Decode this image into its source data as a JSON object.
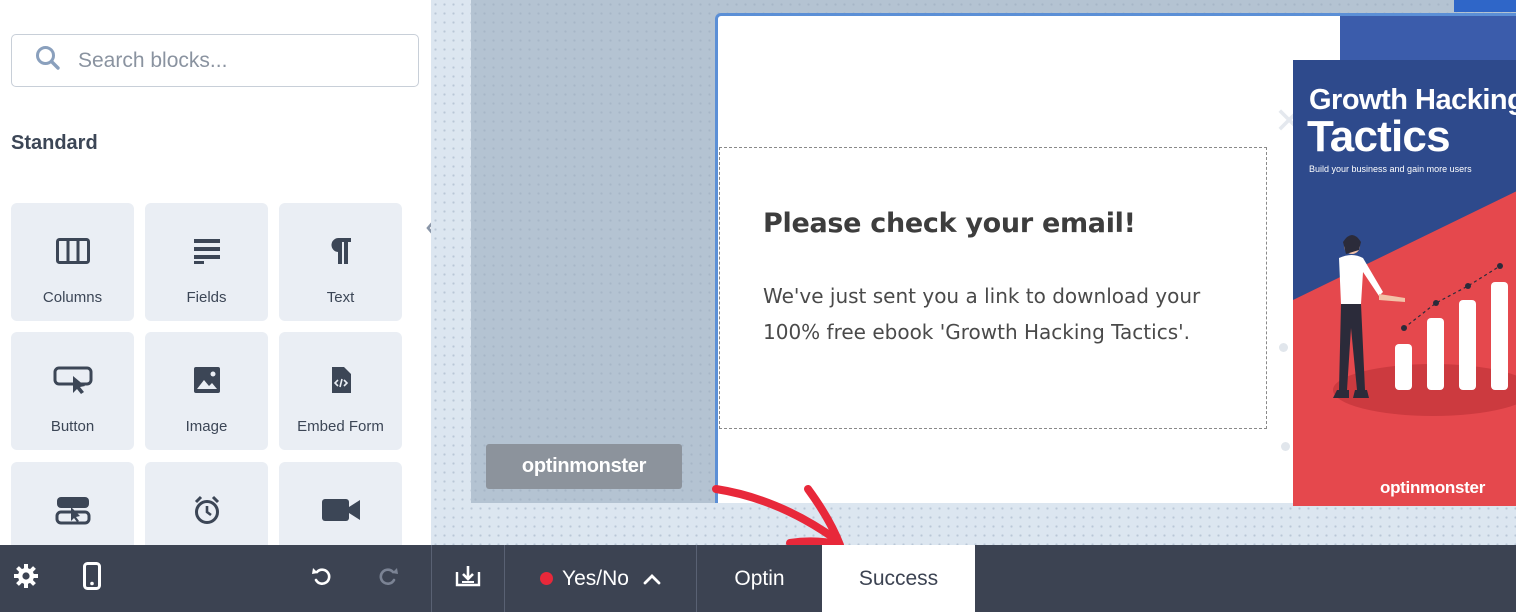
{
  "sidebar": {
    "search": {
      "placeholder": "Search blocks..."
    },
    "section_title": "Standard",
    "blocks": [
      {
        "label": "Columns",
        "icon": "columns-icon"
      },
      {
        "label": "Fields",
        "icon": "fields-icon"
      },
      {
        "label": "Text",
        "icon": "paragraph-icon"
      },
      {
        "label": "Button",
        "icon": "button-icon"
      },
      {
        "label": "Image",
        "icon": "image-icon"
      },
      {
        "label": "Embed Form",
        "icon": "embed-form-icon"
      },
      {
        "label": "",
        "icon": "toggle-button-icon"
      },
      {
        "label": "",
        "icon": "alarm-clock-icon"
      },
      {
        "label": "",
        "icon": "video-camera-icon"
      }
    ]
  },
  "canvas": {
    "badge_text": "optinmonster",
    "popup": {
      "heading": "Please check your email!",
      "body": "We've just sent you a link to download your 100% free ebook 'Growth Hacking Tactics'."
    },
    "ebook": {
      "title_line1": "Growth Hacking",
      "title_line2": "Tactics",
      "subtitle": "Build your business and gain more users",
      "brand": "optinmonster",
      "colors": {
        "top": "#3b5cab",
        "bottom": "#e5484d"
      }
    }
  },
  "bottombar": {
    "icons": [
      "gear-icon",
      "mobile-icon",
      "undo-icon",
      "redo-icon",
      "download-icon"
    ],
    "views": [
      {
        "label": "Yes/No",
        "status_color": "#e8283a"
      },
      {
        "label": "Optin"
      },
      {
        "label": "Success",
        "active": true
      }
    ]
  },
  "colors": {
    "accent_blue": "#5b8fd6",
    "bar_bg": "#3c4352",
    "arrow_red": "#e8283a"
  }
}
